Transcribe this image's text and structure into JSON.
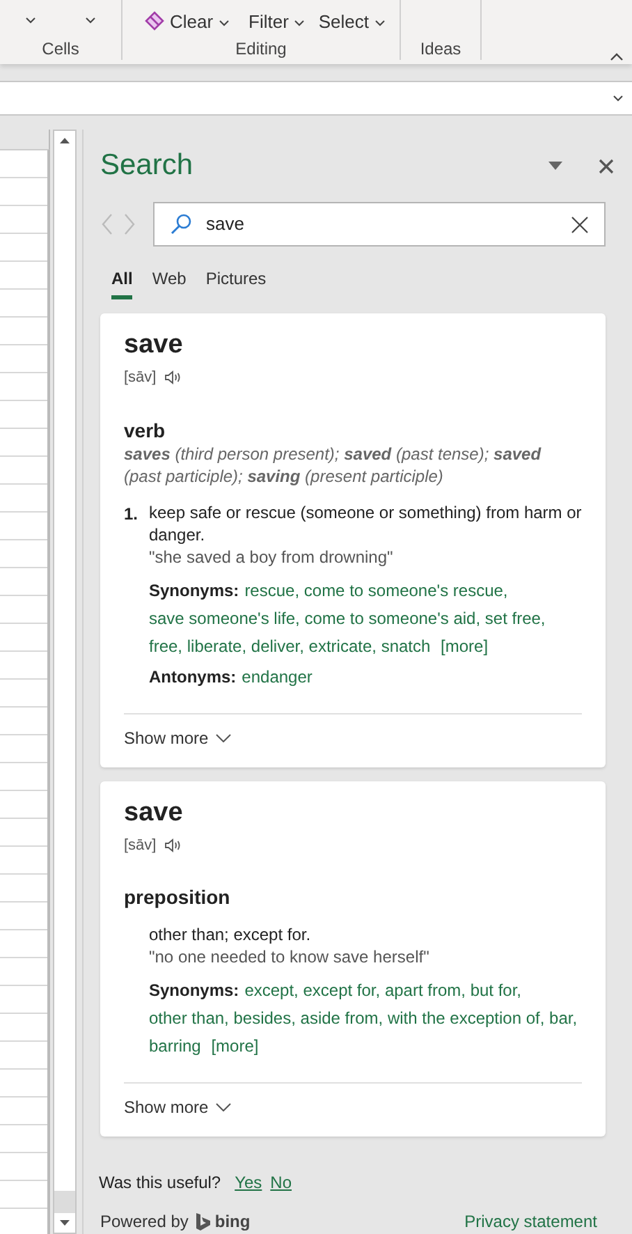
{
  "ribbon": {
    "groups": [
      {
        "label": "Cells",
        "commands": [
          {
            "kind": "chevron"
          },
          {
            "kind": "chevron"
          }
        ]
      },
      {
        "label": "Editing",
        "commands": [
          {
            "kind": "inline",
            "lines": [
              "Clear"
            ]
          },
          {
            "kind": "stacked",
            "lines": [
              "Filter"
            ]
          },
          {
            "kind": "stacked",
            "lines": [
              "Select"
            ]
          }
        ]
      },
      {
        "label": "Ideas"
      }
    ]
  },
  "pane": {
    "title": "Search",
    "search": {
      "value": "save"
    },
    "tabs": [
      {
        "label": "All",
        "selected": true
      },
      {
        "label": "Web",
        "selected": false
      },
      {
        "label": "Pictures",
        "selected": false
      }
    ],
    "cards": [
      {
        "word": "save",
        "pronunciation": "[sāv]",
        "part_of_speech": "verb",
        "forms": "**saves** (third person present); **saved** (past tense); **saved** (past participle); **saving** (present participle)",
        "senses": [
          {
            "number": "1.",
            "definition": "keep safe or rescue (someone or something) from harm or danger.",
            "example": "\"she saved a boy from drowning\"",
            "synonyms_label": "Synonyms:",
            "synonyms": [
              "rescue,",
              "come to someone's rescue,",
              "save someone's life,",
              "come to someone's aid,",
              "set free,",
              "free,",
              "liberate,",
              "deliver,",
              "extricate,",
              "snatch"
            ],
            "more": "[more]",
            "antonyms_label": "Antonyms:",
            "antonyms": [
              "endanger"
            ]
          }
        ],
        "show_more": "Show more"
      },
      {
        "word": "save",
        "pronunciation": "[sāv]",
        "part_of_speech": "preposition",
        "senses": [
          {
            "definition": "other than; except for.",
            "example": "\"no one needed to know save herself\"",
            "synonyms_label": "Synonyms:",
            "synonyms": [
              "except,",
              "except for,",
              "apart from,",
              "but for,",
              "other than,",
              "besides,",
              "aside from,",
              "with the exception of,",
              "bar,",
              "barring"
            ],
            "more": "[more]"
          }
        ],
        "show_more": "Show more"
      }
    ],
    "feedback": {
      "question": "Was this useful?",
      "yes": "Yes",
      "no": "No"
    },
    "powered_by": "Powered by",
    "brand": "bing",
    "privacy": "Privacy statement"
  }
}
